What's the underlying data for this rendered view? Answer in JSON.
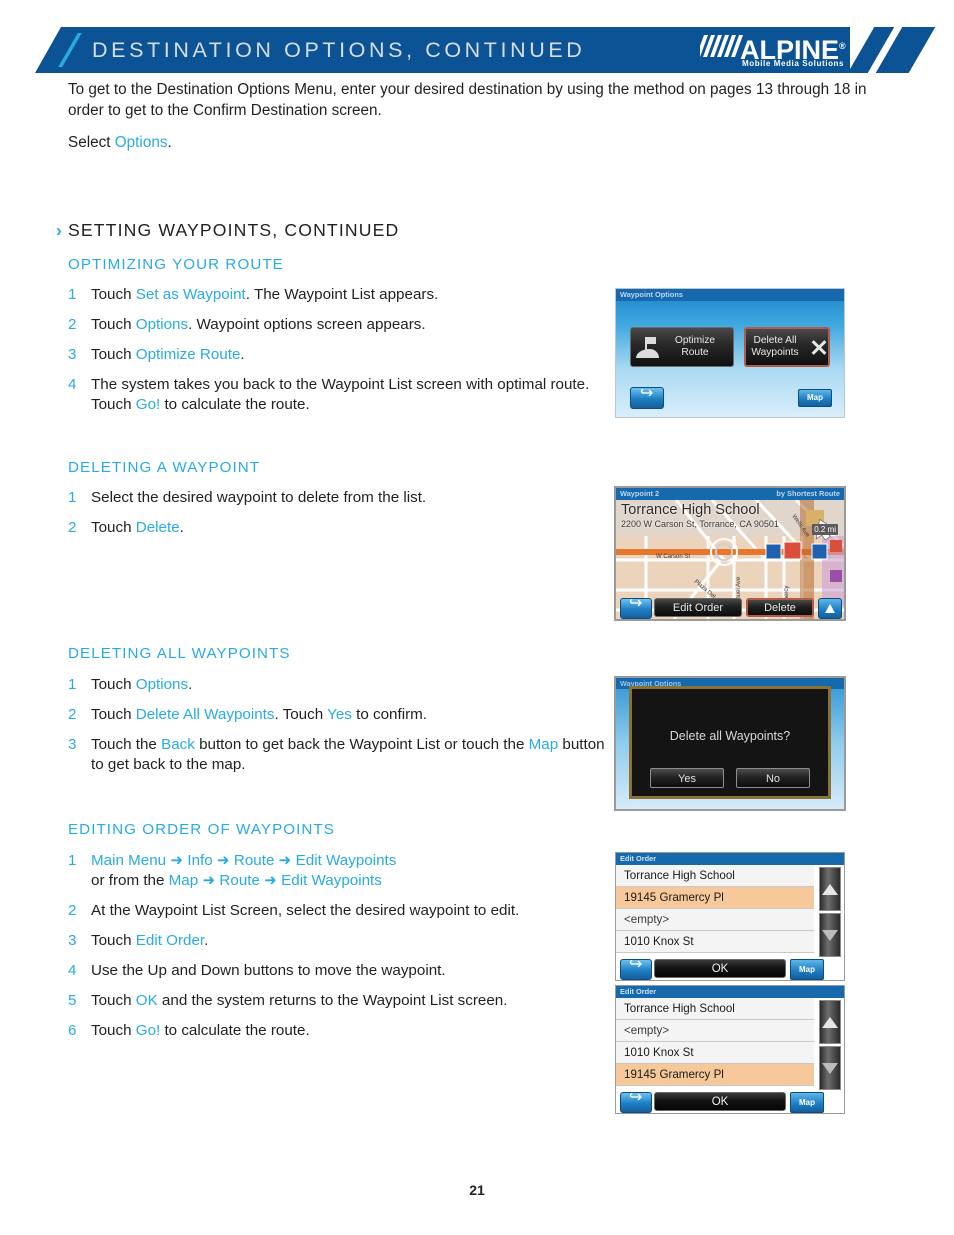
{
  "header": {
    "title": "DESTINATION OPTIONS, CONTINUED",
    "logo_word": "ALPINE",
    "logo_reg": "®",
    "logo_tagline": "Mobile Media Solutions",
    "banner_color": "#0b5394",
    "accent_color": "#29abe2"
  },
  "intro": {
    "p1_a": "To get to the Destination Options Menu, enter your desired destination by using the method on pages 13 through 18 in order to get to the Confirm Destination screen.",
    "p2_a": "Select ",
    "p2_link": "Options",
    "p2_b": "."
  },
  "section": {
    "chevron": "›",
    "title": "SETTING WAYPOINTS, CONTINUED"
  },
  "subsections": {
    "optimizing": {
      "heading": "OPTIMIZING YOUR ROUTE",
      "steps": [
        {
          "num": "1",
          "a": "Touch ",
          "l1": "Set as Waypoint",
          "b": ". The Waypoint List appears."
        },
        {
          "num": "2",
          "a": "Touch ",
          "l1": "Options",
          "b": ". Waypoint options screen appears."
        },
        {
          "num": "3",
          "a": "Touch ",
          "l1": "Optimize Route",
          "b": "."
        },
        {
          "num": "4",
          "a": "The system takes you back to the Waypoint List screen with optimal route. Touch ",
          "l1": "Go!",
          "b": " to calculate the route."
        }
      ]
    },
    "deleting_one": {
      "heading": "DELETING A WAYPOINT",
      "steps": [
        {
          "num": "1",
          "a": "Select the desired waypoint to delete from the list.",
          "l1": "",
          "b": ""
        },
        {
          "num": "2",
          "a": "Touch ",
          "l1": "Delete",
          "b": "."
        }
      ]
    },
    "deleting_all": {
      "heading": "DELETING ALL WAYPOINTS",
      "steps": [
        {
          "num": "1",
          "a": "Touch ",
          "l1": "Options",
          "b": "."
        },
        {
          "num": "2",
          "a": "Touch ",
          "l1": "Delete All Waypoints",
          "b": ". Touch ",
          "l2": "Yes",
          "c": " to confirm."
        },
        {
          "num": "3",
          "a": "Touch the ",
          "l1": "Back",
          "b": " button to get back the Waypoint List or touch the ",
          "l2": "Map",
          "c": " button to get back to the map."
        }
      ]
    },
    "editing_order": {
      "heading": "EDITING ORDER OF WAYPOINTS",
      "steps": [
        {
          "num": "1",
          "line1": [
            "Main Menu",
            "Info",
            "Route",
            "Edit Waypoints"
          ],
          "line2_prefix": "or from the ",
          "line2": [
            "Map",
            "Route",
            "Edit Waypoints"
          ],
          "arrow": "➜"
        },
        {
          "num": "2",
          "a": "At the Waypoint List Screen, select the desired waypoint to edit.",
          "l1": "",
          "b": ""
        },
        {
          "num": "3",
          "a": "Touch ",
          "l1": "Edit Order",
          "b": "."
        },
        {
          "num": "4",
          "a": "Use the Up and Down buttons to move the waypoint.",
          "l1": "",
          "b": ""
        },
        {
          "num": "5",
          "a": "Touch ",
          "l1": "OK",
          "b": " and the system returns to the Waypoint List screen."
        },
        {
          "num": "6",
          "a": "Touch ",
          "l1": "Go!",
          "b": " to calculate the route."
        }
      ]
    }
  },
  "screenshots": {
    "waypoint_options": {
      "titlebar": "Waypoint Options",
      "optimize_line1": "Optimize",
      "optimize_line2": "Route",
      "delete_all_line1": "Delete All",
      "delete_all_line2": "Waypoints",
      "back_label": "",
      "map_label": "Map"
    },
    "map_view": {
      "titlebar_left": "Waypoint 2",
      "titlebar_right": "by Shortest Route",
      "poi_name": "Torrance High School",
      "poi_address": "2200 W Carson St, Torrance, CA 90501",
      "distance": "0.2 mi",
      "street_1": "W Carson St",
      "street_2": "Manuel Ave",
      "street_3": "Gramercy",
      "street_4": "Plaza Del",
      "street_5": "Wells Ave",
      "edit_order_label": "Edit Order",
      "delete_label": "Delete"
    },
    "confirm_dialog": {
      "ghost_titlebar": "Waypoint Options",
      "message": "Delete all Waypoints?",
      "yes_label": "Yes",
      "no_label": "No"
    },
    "edit_order_before": {
      "titlebar": "Edit Order",
      "rows": [
        {
          "text": "Torrance High School",
          "selected": false
        },
        {
          "text": "19145 Gramercy Pl",
          "selected": true
        },
        {
          "text": "<empty>",
          "selected": false
        },
        {
          "text": "1010 Knox St",
          "selected": false
        }
      ],
      "ok_label": "OK",
      "map_label": "Map"
    },
    "edit_order_after": {
      "titlebar": "Edit Order",
      "rows": [
        {
          "text": "Torrance High School",
          "selected": false
        },
        {
          "text": "<empty>",
          "selected": false
        },
        {
          "text": "1010 Knox St",
          "selected": false
        },
        {
          "text": "19145 Gramercy Pl",
          "selected": true
        }
      ],
      "ok_label": "OK",
      "map_label": "Map"
    }
  },
  "footer": {
    "page_number": "21"
  }
}
